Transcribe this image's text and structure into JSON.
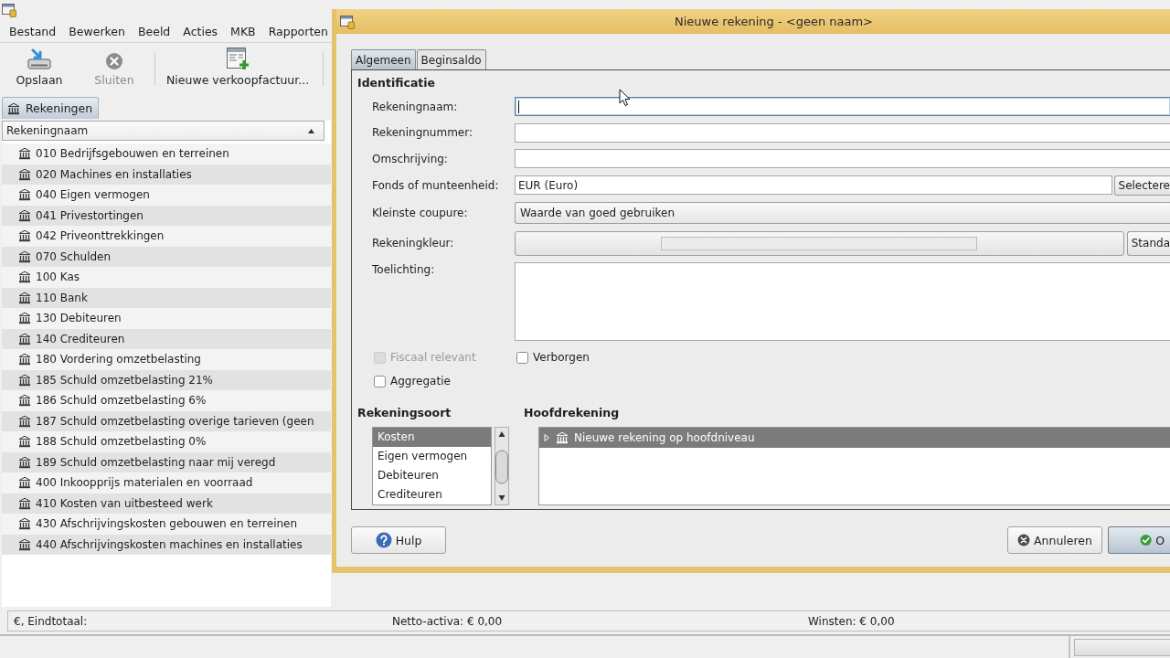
{
  "main_window": {
    "menu": [
      "Bestand",
      "Bewerken",
      "Beeld",
      "Acties",
      "MKB",
      "Rapporten"
    ],
    "toolbar": [
      {
        "kind": "save",
        "label": "Opslaan",
        "disabled": false
      },
      {
        "kind": "close",
        "label": "Sluiten",
        "disabled": true
      },
      {
        "kind": "separator"
      },
      {
        "kind": "invoice",
        "label": "Nieuwe verkoopfactuur...",
        "disabled": false
      },
      {
        "kind": "separator"
      }
    ],
    "tabs": [
      {
        "label": "Rekeningen",
        "selected": true
      }
    ],
    "table": {
      "columns": [
        {
          "label": "Rekeningnaam",
          "sorted": true
        }
      ],
      "rows": [
        {
          "name": "010 Bedrijfsgebouwen en terreinen",
          "selected": false
        },
        {
          "name": "020 Machines en installaties",
          "selected": false
        },
        {
          "name": "040 Eigen vermogen",
          "selected": false
        },
        {
          "name": "041 Privestortingen",
          "selected": false
        },
        {
          "name": "042 Priveonttrekkingen",
          "selected": false
        },
        {
          "name": "070 Schulden",
          "selected": false
        },
        {
          "name": "100 Kas",
          "selected": false
        },
        {
          "name": "110 Bank",
          "selected": false
        },
        {
          "name": "130 Debiteuren",
          "selected": false
        },
        {
          "name": "140 Crediteuren",
          "selected": false
        },
        {
          "name": "180 Vordering omzetbelasting",
          "selected": false
        },
        {
          "name": "185 Schuld omzetbelasting 21%",
          "selected": false
        },
        {
          "name": "186 Schuld omzetbelasting 6%",
          "selected": false
        },
        {
          "name": "187 Schuld omzetbelasting overige tarieven (geen",
          "selected": false
        },
        {
          "name": "188 Schuld omzetbelasting 0%",
          "selected": false
        },
        {
          "name": "189 Schuld omzetbelasting naar mij veregd",
          "selected": false
        },
        {
          "name": "400 Inkoopprijs materialen en voorraad",
          "selected": false
        },
        {
          "name": "410 Kosten van uitbesteed werk",
          "selected": false
        },
        {
          "name": "430 Afschrijvingskosten gebouwen en terreinen",
          "selected": false
        },
        {
          "name": "440 Afschrijvingskosten machines en installaties",
          "selected": false
        }
      ]
    },
    "status_bar": {
      "total": "€, Eindtotaal:",
      "net_assets": "Netto-activa: € 0,00",
      "profit": "Winsten: € 0,00"
    }
  },
  "dialog": {
    "title": "Nieuwe rekening - <geen naam>",
    "tabs": [
      {
        "label": "Algemeen",
        "selected": true
      },
      {
        "label": "Beginsaldo",
        "selected": false
      }
    ],
    "section_title": "Identificatie",
    "fields": [
      {
        "kind": "text",
        "label": "Rekeningnaam:",
        "focused": true
      },
      {
        "kind": "text",
        "label": "Rekeningnummer:",
        "focused": false
      },
      {
        "kind": "text",
        "label": "Omschrijving:",
        "focused": false
      },
      {
        "kind": "text",
        "label": "Fonds of munteenheid:",
        "value": "EUR (Euro)",
        "focused": false,
        "button": "Selectere"
      },
      {
        "kind": "combo",
        "label": "Kleinste coupure:",
        "value": "Waarde van goed gebruiken"
      },
      {
        "kind": "color",
        "label": "Rekeningkleur:",
        "button": "Standa"
      },
      {
        "kind": "textarea",
        "label": "Toelichting:",
        "focused": false
      }
    ],
    "checkboxes": [
      {
        "label": "Fiscaal relevant",
        "checked": false,
        "disabled": true
      },
      {
        "label": "Verborgen",
        "checked": false,
        "disabled": false
      },
      {
        "label": "Aggregatie",
        "checked": false,
        "disabled": false
      }
    ],
    "account_type": {
      "title": "Rekeningsoort",
      "items": [
        {
          "label": "Kosten",
          "selected": true
        },
        {
          "label": "Eigen vermogen",
          "selected": false
        },
        {
          "label": "Debiteuren",
          "selected": false
        },
        {
          "label": "Crediteuren",
          "selected": false
        }
      ]
    },
    "parent_account": {
      "title": "Hoofdrekening",
      "items": [
        {
          "label": "Nieuwe rekening op hoofdniveau",
          "selected": true,
          "expanded": false
        }
      ]
    },
    "buttons": [
      {
        "kind": "help",
        "label": "Hulp"
      },
      {
        "kind": "cancel",
        "label": "Annuleren"
      },
      {
        "kind": "ok",
        "label": "O"
      }
    ]
  }
}
